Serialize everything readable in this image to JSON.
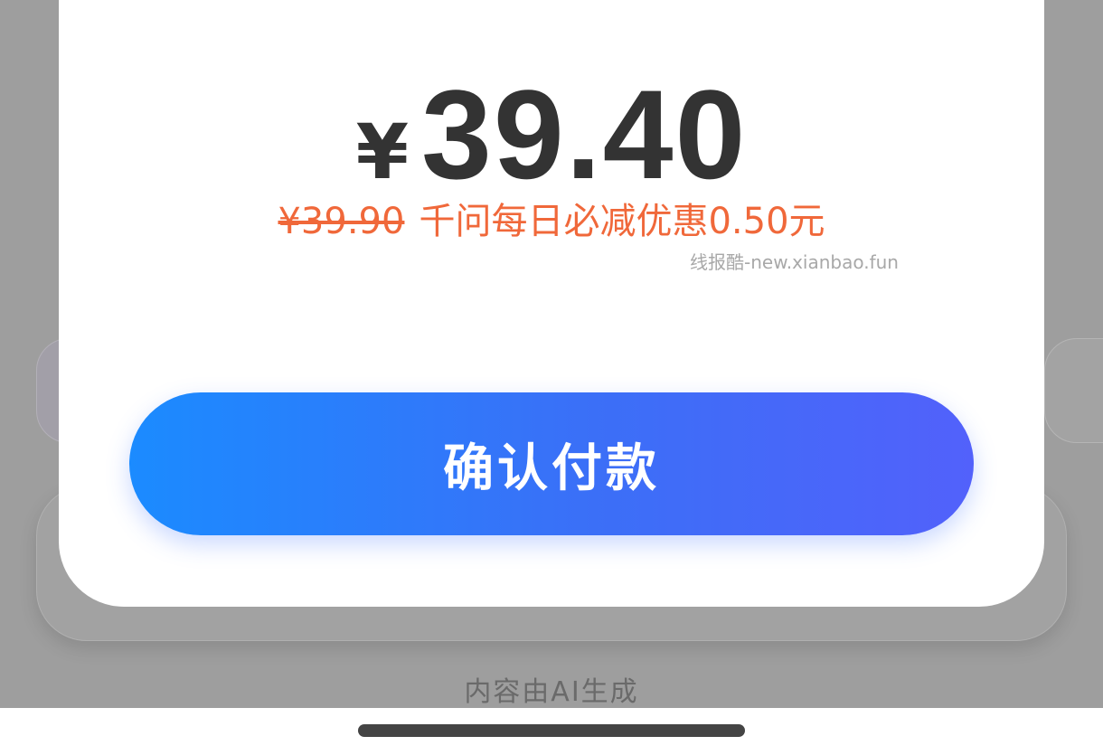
{
  "payment": {
    "currency_symbol": "¥",
    "amount": "39.40",
    "original_price": "¥39.90",
    "discount_text": "千问每日必减优惠0.50元",
    "confirm_label": "确认付款"
  },
  "watermark": "线报酷-new.xianbao.fun",
  "background": {
    "ai_note": "内容由AI生成",
    "right_icon": "video-icon"
  },
  "colors": {
    "price": "#333333",
    "discount": "#f0683a",
    "button_start": "#1b8bff",
    "button_end": "#5261fb",
    "overlay": "#9e9e9e"
  }
}
